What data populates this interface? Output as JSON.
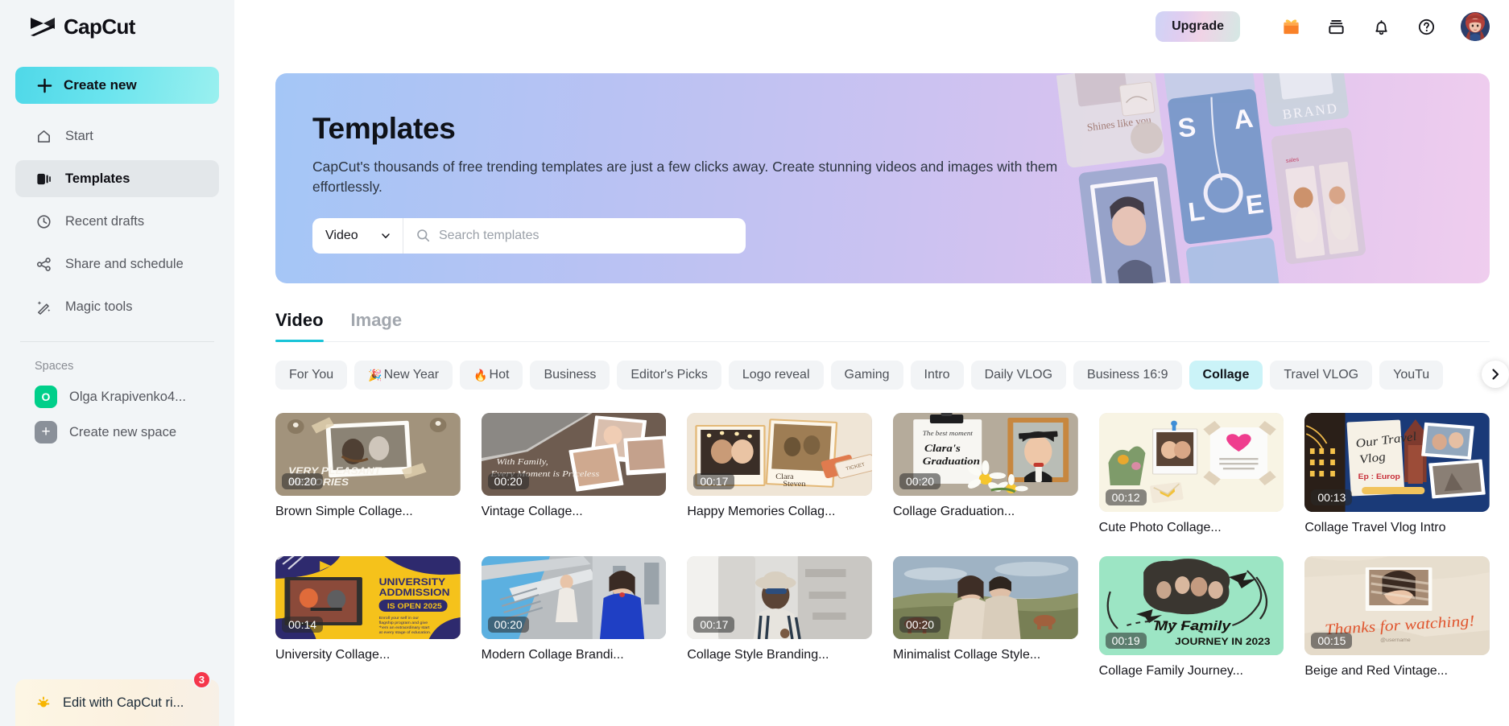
{
  "brand": {
    "name": "CapCut",
    "accent": "#19c4d8"
  },
  "sidebar": {
    "create_new": "Create new",
    "items": [
      {
        "label": "Start",
        "icon": "home-icon"
      },
      {
        "label": "Templates",
        "icon": "templates-icon"
      },
      {
        "label": "Recent drafts",
        "icon": "clock-icon"
      },
      {
        "label": "Share and schedule",
        "icon": "share-icon"
      },
      {
        "label": "Magic tools",
        "icon": "magic-wand-icon"
      }
    ],
    "spaces_label": "Spaces",
    "spaces": [
      {
        "label": "Olga Krapivenko4...",
        "initial": "O",
        "color": "#00cf8a"
      },
      {
        "label": "Create new space",
        "initial": "+",
        "color": "#8a9099"
      }
    ],
    "promo": {
      "label": "Edit with CapCut ri...",
      "badge": "3",
      "icon": "sun-icon"
    }
  },
  "topbar": {
    "upgrade_label": "Upgrade",
    "icons": [
      {
        "name": "gift-icon"
      },
      {
        "name": "inbox-icon"
      },
      {
        "name": "bell-icon"
      },
      {
        "name": "help-circle-icon"
      }
    ],
    "avatar": "avatar"
  },
  "banner": {
    "title": "Templates",
    "description": "CapCut's thousands of free trending templates are just a few clicks away. Create stunning videos and images with them effortlessly.",
    "type_selector": {
      "value": "Video",
      "icon": "chevron-down-icon"
    },
    "search": {
      "placeholder": "Search templates",
      "value": "",
      "icon": "search-icon"
    },
    "art_texts": [
      "Shines like you",
      "S",
      "A",
      "L",
      "E",
      "BRAND"
    ]
  },
  "tabs": [
    {
      "label": "Video",
      "active": true
    },
    {
      "label": "Image",
      "active": false
    }
  ],
  "chips": [
    {
      "label": "For You",
      "emoji": "",
      "active": false
    },
    {
      "label": "New Year",
      "emoji": "🎉",
      "active": false
    },
    {
      "label": "Hot",
      "emoji": "🔥",
      "active": false
    },
    {
      "label": "Business",
      "emoji": "",
      "active": false
    },
    {
      "label": "Editor's Picks",
      "emoji": "",
      "active": false
    },
    {
      "label": "Logo reveal",
      "emoji": "",
      "active": false
    },
    {
      "label": "Gaming",
      "emoji": "",
      "active": false
    },
    {
      "label": "Intro",
      "emoji": "",
      "active": false
    },
    {
      "label": "Daily VLOG",
      "emoji": "",
      "active": false
    },
    {
      "label": "Business 16:9",
      "emoji": "",
      "active": false
    },
    {
      "label": "Collage",
      "emoji": "",
      "active": true
    },
    {
      "label": "Travel VLOG",
      "emoji": "",
      "active": false
    },
    {
      "label": "YouTu",
      "emoji": "",
      "active": false
    }
  ],
  "chips_next_icon": "chevron-right-icon",
  "templates_row1": [
    {
      "title": "Brown Simple Collage...",
      "duration": "00:20",
      "overlay": "VERY PLEASANT MEMORIES"
    },
    {
      "title": "Vintage Collage...",
      "duration": "00:20",
      "overlay": "With Family, Every Moment is Priceless"
    },
    {
      "title": "Happy Memories Collag...",
      "duration": "00:17",
      "overlay": "Clara & Steven"
    },
    {
      "title": "Collage Graduation...",
      "duration": "00:20",
      "overlay": "Clara's Graduation"
    },
    {
      "title": "Cute Photo Collage...",
      "duration": "00:12",
      "overlay": ""
    },
    {
      "title": "Collage Travel Vlog Intro",
      "duration": "00:13",
      "overlay": "Our Travel Vlog Ep : Europ"
    }
  ],
  "templates_row2": [
    {
      "title": "University Collage...",
      "duration": "00:14",
      "overlay": "UNIVERSITY ADDMISSION IS OPEN 2025"
    },
    {
      "title": "Modern Collage Brandi...",
      "duration": "00:20",
      "overlay": ""
    },
    {
      "title": "Collage Style Branding...",
      "duration": "00:17",
      "overlay": ""
    },
    {
      "title": "Minimalist Collage Style...",
      "duration": "00:20",
      "overlay": ""
    },
    {
      "title": "Collage Family Journey...",
      "duration": "00:19",
      "overlay": "My Family JOURNEY IN 2023"
    },
    {
      "title": "Beige and Red Vintage...",
      "duration": "00:15",
      "overlay": "Thanks for watching!"
    }
  ]
}
